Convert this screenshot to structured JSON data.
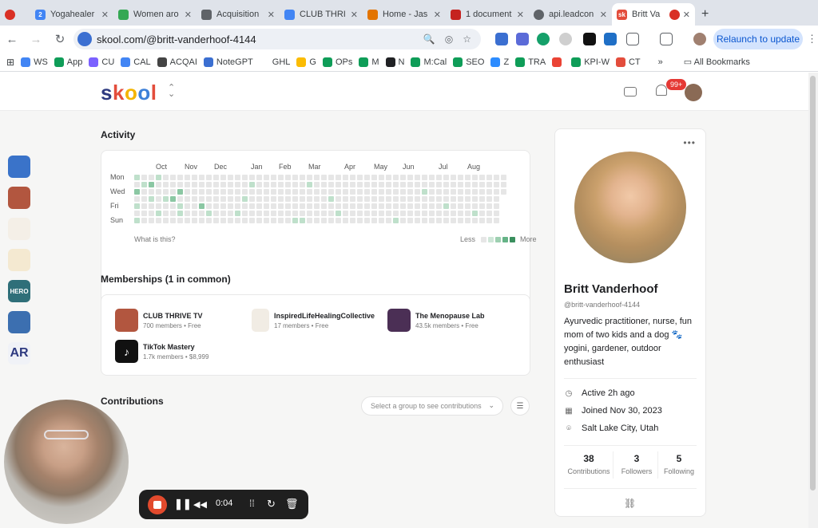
{
  "browser": {
    "tabs": [
      {
        "label": "",
        "color": "#d93025"
      },
      {
        "label": "Yogahealer",
        "color": "#4285f4"
      },
      {
        "label": "Women aro",
        "color": "#34a853"
      },
      {
        "label": "Acquisition",
        "color": "#5f6368"
      },
      {
        "label": "CLUB THRI",
        "color": "#4285f4"
      },
      {
        "label": "Home - Jas",
        "color": "#e37400"
      },
      {
        "label": "1 document",
        "color": "#c5221f"
      },
      {
        "label": "api.leadcon",
        "color": "#5f6368"
      },
      {
        "label": "Britt Va",
        "color": "#e34d3c"
      }
    ],
    "url": "skool.com/@britt-vanderhoof-4144",
    "relaunch_label": "Relaunch to update",
    "bookmarks": [
      {
        "label": "",
        "color": "#5f6368"
      },
      {
        "label": "WS",
        "color": "#4285f4"
      },
      {
        "label": "App",
        "color": "#0f9d58"
      },
      {
        "label": "CU",
        "color": "#7b61ff"
      },
      {
        "label": "CAL",
        "color": "#4285f4"
      },
      {
        "label": "ACQAI",
        "color": "#444"
      },
      {
        "label": "NoteGPT",
        "color": "#3b6fd1"
      },
      {
        "label": "GHL",
        "color": "#fff"
      },
      {
        "label": "G",
        "color": "#fbbc04"
      },
      {
        "label": "OPs",
        "color": "#0f9d58"
      },
      {
        "label": "M",
        "color": "#0f9d58"
      },
      {
        "label": "N",
        "color": "#202124"
      },
      {
        "label": "M:Cal",
        "color": "#0f9d58"
      },
      {
        "label": "SEO",
        "color": "#0f9d58"
      },
      {
        "label": "Z",
        "color": "#2d8cff"
      },
      {
        "label": "TRA",
        "color": "#0f9d58"
      },
      {
        "label": "",
        "color": "#ea4335"
      },
      {
        "label": "KPI-W",
        "color": "#0f9d58"
      },
      {
        "label": "CT",
        "color": "#e34d3c"
      }
    ],
    "more_label": "»",
    "all_bookmarks_label": "All Bookmarks"
  },
  "header": {
    "logo": {
      "s": "s",
      "k": "k",
      "o1": "o",
      "o2": "o",
      "l": "l"
    },
    "notif_count": "99+"
  },
  "activity": {
    "title": "Activity",
    "months": [
      "Oct",
      "Nov",
      "Dec",
      "Jan",
      "Feb",
      "Mar",
      "Apr",
      "May",
      "Jun",
      "Jul",
      "Aug"
    ],
    "days": [
      "Mon",
      "Wed",
      "Fri",
      "Sun"
    ],
    "help_link": "What is this?",
    "less_label": "Less",
    "more_label": "More"
  },
  "memberships": {
    "title": "Memberships (1 in common)",
    "items": [
      {
        "name": "CLUB THRIVE TV",
        "sub": "700 members • Free",
        "color": "#b2563f"
      },
      {
        "name": "InspiredLifeHealingCollective",
        "sub": "17 members • Free",
        "color": "#f1ece4"
      },
      {
        "name": "The Menopause Lab",
        "sub": "43.5k members • Free",
        "color": "#4b2f55"
      },
      {
        "name": "TikTok Mastery",
        "sub": "1.7k members • $8,999",
        "color": "#111111"
      }
    ]
  },
  "contributions": {
    "title": "Contributions",
    "select_placeholder": "Select a group to see contributions"
  },
  "groups_rail": [
    {
      "label": "",
      "color": "#3a73c9"
    },
    {
      "label": "",
      "color": "#b2563f"
    },
    {
      "label": "",
      "color": "#f4efe7"
    },
    {
      "label": "",
      "color": "#f4e9d1"
    },
    {
      "label": "HERO",
      "color": "#2f6f79"
    },
    {
      "label": "",
      "color": "#3c6fb0"
    },
    {
      "label": "AR",
      "color": "#f0f2f7"
    }
  ],
  "profile": {
    "name": "Britt Vanderhoof",
    "handle": "@britt-vanderhoof-4144",
    "bio": "Ayurvedic practitioner, nurse, fun mom of two kids and a dog 🐾 yogini, gardener, outdoor enthusiast",
    "active": "Active 2h ago",
    "joined": "Joined Nov 30, 2023",
    "location": "Salt Lake City, Utah",
    "contributions": "38",
    "contributions_label": "Contributions",
    "followers": "3",
    "followers_label": "Followers",
    "following": "5",
    "following_label": "Following"
  },
  "recorder": {
    "time": "0:04"
  }
}
